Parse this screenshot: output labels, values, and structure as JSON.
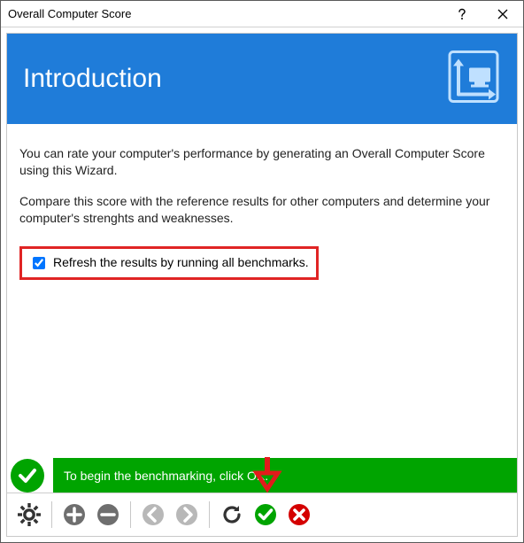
{
  "window": {
    "title": "Overall Computer Score"
  },
  "header": {
    "heading": "Introduction"
  },
  "body": {
    "para1": "You can rate your computer's performance by generating an Overall Computer Score using this Wizard.",
    "para2": "Compare this score with the reference results for other computers and determine your computer's strenghts and weaknesses.",
    "checkbox_label": "Refresh the results by running all benchmarks.",
    "checkbox_checked": true
  },
  "status": {
    "message": "To begin the benchmarking, click OK."
  },
  "colors": {
    "header_bg": "#1f7cd9",
    "status_green": "#00a400",
    "highlight_red": "#e02424",
    "arrow_red": "#e21b1b"
  }
}
